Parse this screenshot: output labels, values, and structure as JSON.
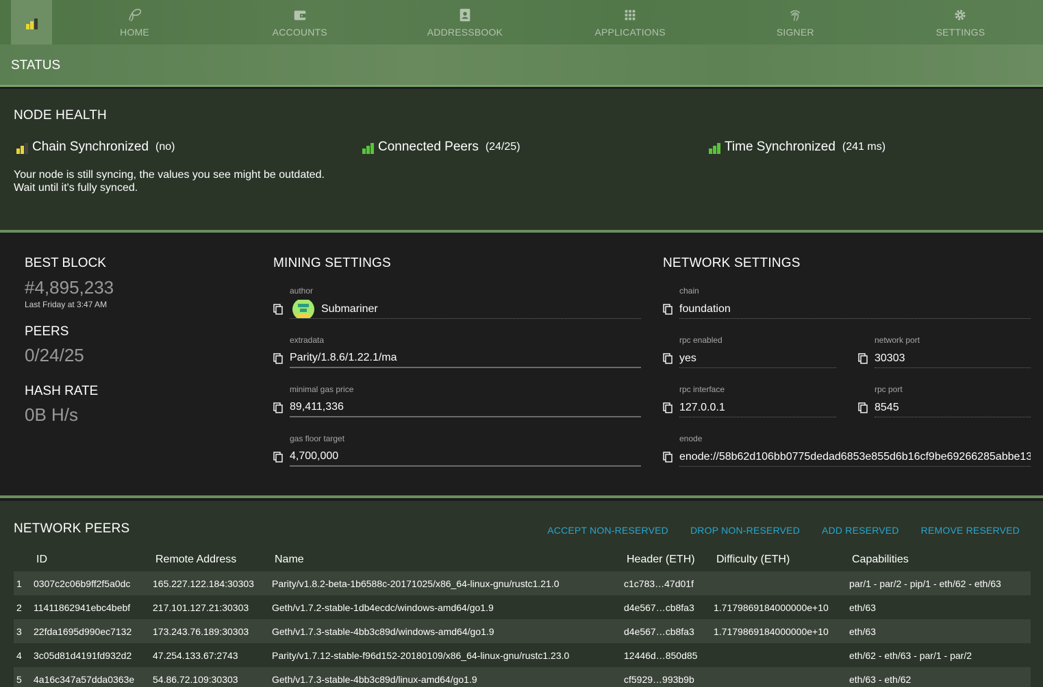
{
  "nav": {
    "items": [
      {
        "label": "HOME",
        "icon": "parity-logo-icon"
      },
      {
        "label": "ACCOUNTS",
        "icon": "wallet-icon"
      },
      {
        "label": "ADDRESSBOOK",
        "icon": "contacts-icon"
      },
      {
        "label": "APPLICATIONS",
        "icon": "grid-icon"
      },
      {
        "label": "SIGNER",
        "icon": "fingerprint-icon"
      },
      {
        "label": "SETTINGS",
        "icon": "gear-icon"
      }
    ]
  },
  "status_bar": {
    "title": "STATUS"
  },
  "node_health": {
    "title": "NODE HEALTH",
    "chain": {
      "label": "Chain Synchronized",
      "detail": "(no)"
    },
    "peers": {
      "label": "Connected Peers",
      "detail": "(24/25)"
    },
    "time": {
      "label": "Time Synchronized",
      "detail": "(241 ms)"
    },
    "message_line1": "Your node is still syncing, the values you see might be outdated.",
    "message_line2": "Wait until it's fully synced."
  },
  "best_block": {
    "title": "BEST BLOCK",
    "value": "#4,895,233",
    "sub": "Last Friday at 3:47 AM"
  },
  "peers_stat": {
    "title": "PEERS",
    "value": "0/24/25"
  },
  "hash_rate": {
    "title": "HASH RATE",
    "value": "0B H/s"
  },
  "mining": {
    "title": "MINING SETTINGS",
    "author": {
      "label": "author",
      "value": "Submariner"
    },
    "extradata": {
      "label": "extradata",
      "value": "Parity/1.8.6/1.22.1/ma"
    },
    "gas_price": {
      "label": "minimal gas price",
      "value": "89,411,336"
    },
    "gas_floor": {
      "label": "gas floor target",
      "value": "4,700,000"
    }
  },
  "network": {
    "title": "NETWORK SETTINGS",
    "chain": {
      "label": "chain",
      "value": "foundation"
    },
    "rpc_enabled": {
      "label": "rpc enabled",
      "value": "yes"
    },
    "network_port": {
      "label": "network port",
      "value": "30303"
    },
    "rpc_interface": {
      "label": "rpc interface",
      "value": "127.0.0.1"
    },
    "rpc_port": {
      "label": "rpc port",
      "value": "8545"
    },
    "enode": {
      "label": "enode",
      "value": "enode://58b62d106bb0775dedad6853e855d6b16cf9be69266285abbe13"
    }
  },
  "network_peers": {
    "title": "NETWORK PEERS",
    "actions": [
      "ACCEPT NON-RESERVED",
      "DROP NON-RESERVED",
      "ADD RESERVED",
      "REMOVE RESERVED"
    ],
    "columns": [
      "ID",
      "Remote Address",
      "Name",
      "Header (ETH)",
      "Difficulty (ETH)",
      "Capabilities"
    ],
    "rows": [
      [
        "1",
        "0307c2c06b9ff2f5a0dc",
        "165.227.122.184:30303",
        "Parity/v1.8.2-beta-1b6588c-20171025/x86_64-linux-gnu/rustc1.21.0",
        "c1c783…47d01f",
        "",
        "par/1 - par/2 - pip/1 - eth/62 - eth/63"
      ],
      [
        "2",
        "11411862941ebc4bebf",
        "217.101.127.21:30303",
        "Geth/v1.7.2-stable-1db4ecdc/windows-amd64/go1.9",
        "d4e567…cb8fa3",
        "1.7179869184000000e+10",
        "eth/63"
      ],
      [
        "3",
        "22fda1695d990ec7132",
        "173.243.76.189:30303",
        "Geth/v1.7.3-stable-4bb3c89d/windows-amd64/go1.9",
        "d4e567…cb8fa3",
        "1.7179869184000000e+10",
        "eth/63"
      ],
      [
        "4",
        "3c05d81d4191fd932d2",
        "47.254.133.67:2743",
        "Parity/v1.7.12-stable-f96d152-20180109/x86_64-linux-gnu/rustc1.23.0",
        "12446d…850d85",
        "",
        "eth/62 - eth/63 - par/1 - par/2"
      ],
      [
        "5",
        "4a16c347a57dda0363e",
        "54.86.72.109:30303",
        "Geth/v1.7.3-stable-4bb3c89d/linux-amd64/go1.9",
        "cf5929…993b9b",
        "",
        "eth/63 - eth/62"
      ]
    ]
  },
  "colors": {
    "accent": "#2aa6d0",
    "health_green": "#58c43a",
    "health_yellow": "#e8d43a"
  }
}
